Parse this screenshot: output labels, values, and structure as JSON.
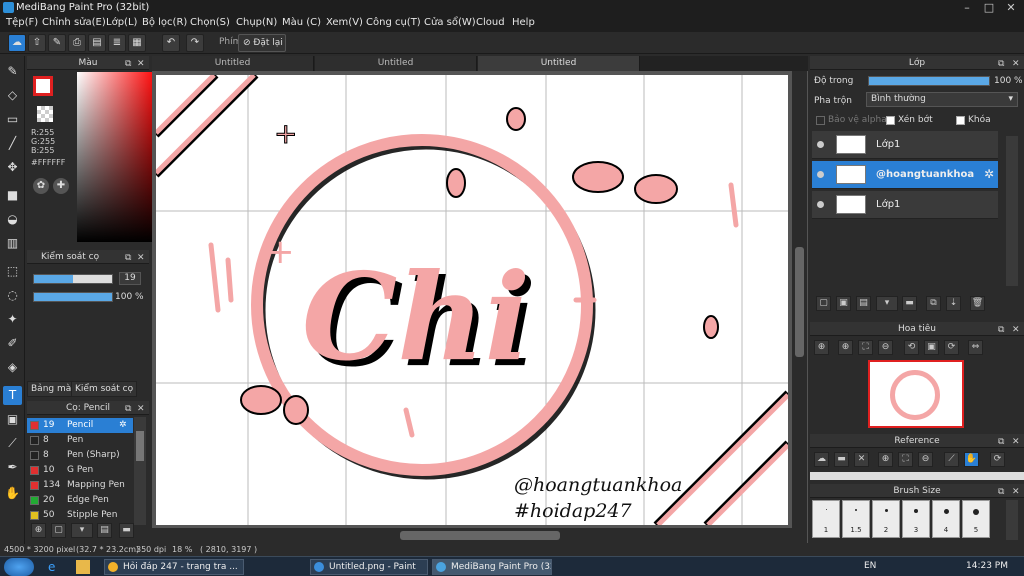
{
  "window": {
    "title": "MediBang Paint Pro (32bit)"
  },
  "menu": [
    "Tệp(F)",
    "Chỉnh sửa(E)",
    "Lớp(L)",
    "Bộ lọc(R)",
    "Chọn(S)",
    "Chụp(N)",
    "Màu (C)",
    "Xem(V)",
    "Công cụ(T)",
    "Cửa sổ(W)",
    "Cloud",
    "Help"
  ],
  "toolbar": {
    "key_label": "Phím",
    "reset_label": "Đặt lại"
  },
  "color_panel": {
    "title": "Màu",
    "r": "R:255",
    "g": "G:255",
    "b": "B:255",
    "hex": "#FFFFFF"
  },
  "brush_control": {
    "title": "Kiểm soát cọ",
    "size": "19",
    "opacity": "100 %",
    "size_fraction": 0.5,
    "opacity_fraction": 1.0
  },
  "panel_tabs": {
    "color_bank": "Bảng màu",
    "brush_control": "Kiểm soát cọ"
  },
  "brush_panel": {
    "title": "Cọ: Pencil",
    "brushes": [
      {
        "size": "19",
        "name": "Pencil",
        "color": "#e03030",
        "selected": true
      },
      {
        "size": "8",
        "name": "Pen",
        "color": "#222222",
        "selected": false
      },
      {
        "size": "8",
        "name": "Pen (Sharp)",
        "color": "#222222",
        "selected": false
      },
      {
        "size": "10",
        "name": "G Pen",
        "color": "#e03030",
        "selected": false
      },
      {
        "size": "134",
        "name": "Mapping Pen",
        "color": "#e03030",
        "selected": false
      },
      {
        "size": "20",
        "name": "Edge Pen",
        "color": "#22aa33",
        "selected": false
      },
      {
        "size": "50",
        "name": "Stipple Pen",
        "color": "#e0c020",
        "selected": false
      }
    ]
  },
  "tabs": [
    "Untitled",
    "Untitled",
    "Untitled"
  ],
  "artwork": {
    "main_text": "Chi",
    "handle": "@hoangtuankhoa",
    "hashtag": "#hoidap247",
    "accent": "#f4a6a6"
  },
  "layers_panel": {
    "title": "Lớp",
    "opacity_label": "Độ trong",
    "opacity_value": "100 %",
    "opacity_fraction": 1.0,
    "blend_label": "Pha trộn",
    "blend_value": "Bình thường",
    "protect_alpha": "Bảo vệ alpha",
    "clipping": "Xén bớt",
    "lock": "Khóa",
    "layers": [
      {
        "name": "Lớp1",
        "selected": false
      },
      {
        "name": "@hoangtuankhoa",
        "selected": true
      },
      {
        "name": "Lớp1",
        "selected": false
      }
    ]
  },
  "navigator": {
    "title": "Hoa tiêu"
  },
  "reference": {
    "title": "Reference"
  },
  "brush_size": {
    "title": "Brush Size",
    "sizes": [
      "1",
      "1.5",
      "2",
      "3",
      "4",
      "5"
    ]
  },
  "status": {
    "dimensions": "4500 * 3200 pixel",
    "size_cm": "(32.7 * 23.2cm)",
    "dpi": "350 dpi",
    "zoom": "18 %",
    "coords": "( 2810, 3197 )"
  },
  "taskbar": {
    "tasks": [
      {
        "label": "Hỏi đáp 247 - trang tra ...",
        "color": "#f2b12a"
      },
      {
        "label": "Untitled.png - Paint",
        "color": "#3b8edb"
      },
      {
        "label": "MediBang Paint Pro (32...",
        "color": "#4aa3df"
      }
    ],
    "lang": "EN",
    "time": "14:23 PM"
  }
}
